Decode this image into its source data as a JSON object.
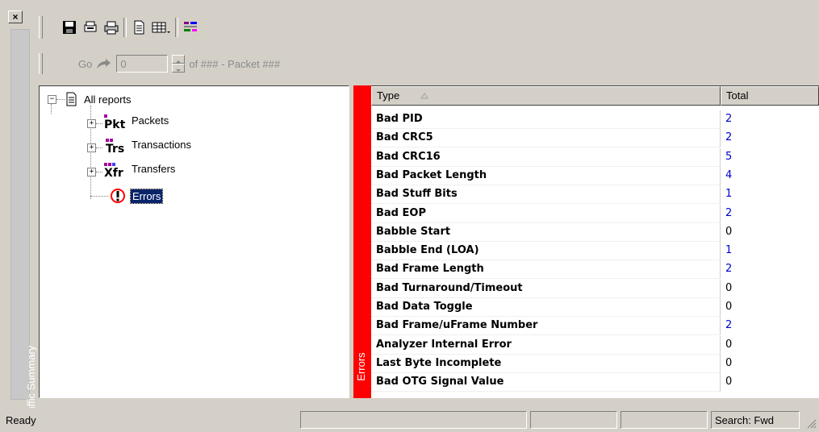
{
  "side_strip": {
    "label": "Traffic Summary"
  },
  "toolbar": {
    "icons": [
      "save-icon",
      "print-preview-icon",
      "print-icon",
      "document-icon",
      "grid-view-icon",
      "summary-view-icon"
    ]
  },
  "nav": {
    "go_label": "Go",
    "packet_value": "0",
    "packet_of_label": "of ### - Packet ###"
  },
  "tree": {
    "root_label": "All reports",
    "items": [
      {
        "badge": "Pkt",
        "label": "Packets"
      },
      {
        "badge": "Trs",
        "label": "Transactions"
      },
      {
        "badge": "Xfr",
        "label": "Transfers"
      },
      {
        "label": "Errors"
      }
    ]
  },
  "errors_bar": {
    "label": "Errors"
  },
  "table": {
    "headers": {
      "type": "Type",
      "total": "Total"
    },
    "rows": [
      {
        "type": "Bad PID",
        "total": "2"
      },
      {
        "type": "Bad CRC5",
        "total": "2"
      },
      {
        "type": "Bad CRC16",
        "total": "5"
      },
      {
        "type": "Bad Packet Length",
        "total": "4"
      },
      {
        "type": "Bad Stuff Bits",
        "total": "1"
      },
      {
        "type": "Bad EOP",
        "total": "2"
      },
      {
        "type": "Babble Start",
        "total": "0"
      },
      {
        "type": "Babble End (LOA)",
        "total": "1"
      },
      {
        "type": "Bad Frame Length",
        "total": "2"
      },
      {
        "type": "Bad Turnaround/Timeout",
        "total": "0"
      },
      {
        "type": "Bad Data Toggle",
        "total": "0"
      },
      {
        "type": "Bad Frame/uFrame Number",
        "total": "2"
      },
      {
        "type": "Analyzer Internal Error",
        "total": "0"
      },
      {
        "type": "Last Byte Incomplete",
        "total": "0"
      },
      {
        "type": "Bad OTG Signal Value",
        "total": "0"
      }
    ]
  },
  "status": {
    "ready": "Ready",
    "search": "Search: Fwd"
  },
  "colors": {
    "errors_bar": "#ff0000",
    "link_value": "#0000cc",
    "chrome": "#d4d0c8"
  }
}
